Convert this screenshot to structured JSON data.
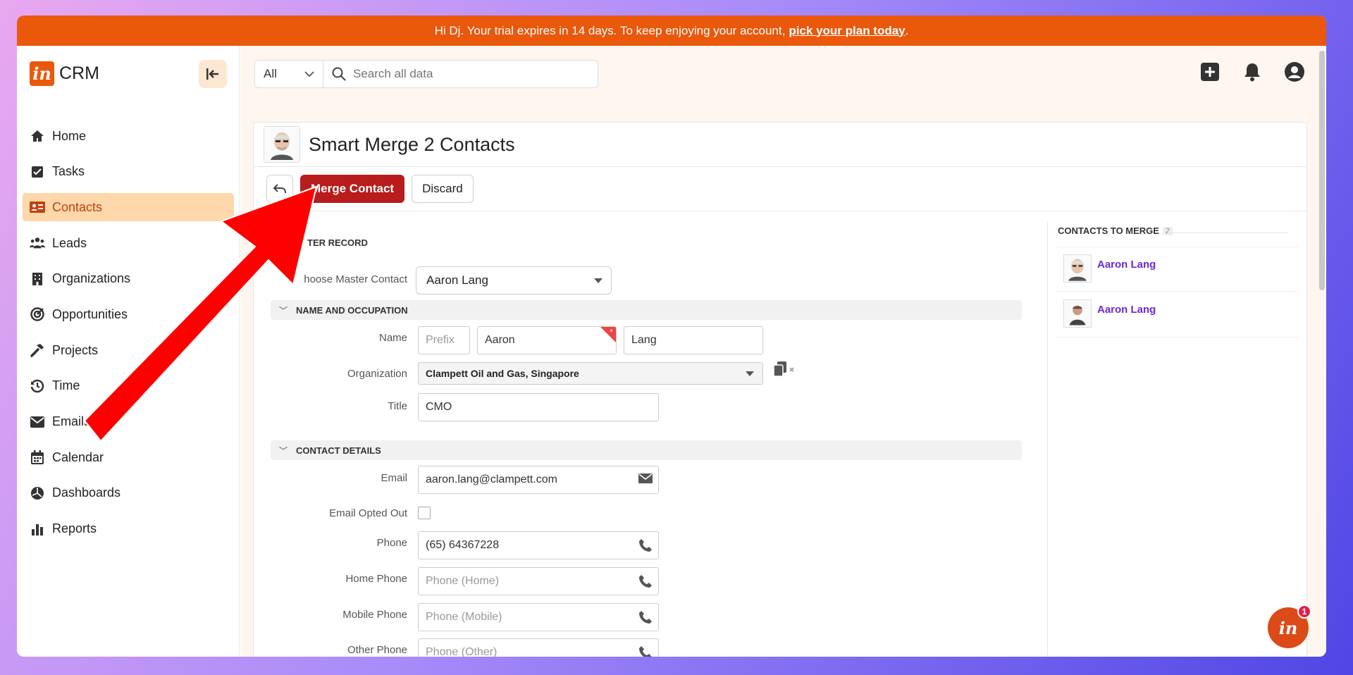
{
  "banner": {
    "text": "Hi Dj. Your trial expires in 14 days. To keep enjoying your account,",
    "link": "pick your plan today",
    "suffix": "."
  },
  "brand": {
    "logo": "in",
    "name": "CRM"
  },
  "nav": [
    {
      "label": "Home",
      "icon": "home-icon"
    },
    {
      "label": "Tasks",
      "icon": "checkbox-icon"
    },
    {
      "label": "Contacts",
      "icon": "contact-card-icon",
      "active": true
    },
    {
      "label": "Leads",
      "icon": "users-icon"
    },
    {
      "label": "Organizations",
      "icon": "building-icon"
    },
    {
      "label": "Opportunities",
      "icon": "target-icon"
    },
    {
      "label": "Projects",
      "icon": "hammer-icon"
    },
    {
      "label": "Time",
      "icon": "clock-icon"
    },
    {
      "label": "Emails",
      "icon": "envelope-icon"
    },
    {
      "label": "Calendar",
      "icon": "calendar-icon"
    },
    {
      "label": "Dashboards",
      "icon": "chart-pie-icon"
    },
    {
      "label": "Reports",
      "icon": "bar-chart-icon"
    }
  ],
  "search": {
    "scope": "All",
    "placeholder": "Search all data"
  },
  "page": {
    "title": "Smart Merge 2 Contacts",
    "merge_label": "Merge Contact",
    "discard_label": "Discard",
    "master_section": "TER RECORD",
    "master_label": "hoose Master Contact",
    "master_value": "Aaron Lang"
  },
  "sections": {
    "name_occupation": "NAME AND OCCUPATION",
    "contact_details": "CONTACT DETAILS"
  },
  "fields": {
    "name_label": "Name",
    "prefix_placeholder": "Prefix",
    "first_name": "Aaron",
    "last_name": "Lang",
    "org_label": "Organization",
    "org_value": "Clampett Oil and Gas, Singapore",
    "title_label": "Title",
    "title_value": "CMO",
    "email_label": "Email",
    "email_value": "aaron.lang@clampett.com",
    "opted_out_label": "Email Opted Out",
    "phone_label": "Phone",
    "phone_value": "(65) 64367228",
    "home_phone_label": "Home Phone",
    "home_phone_placeholder": "Phone (Home)",
    "mobile_phone_label": "Mobile Phone",
    "mobile_phone_placeholder": "Phone (Mobile)",
    "other_phone_label": "Other Phone",
    "other_phone_placeholder": "Phone (Other)"
  },
  "merge_panel": {
    "title": "CONTACTS TO MERGE",
    "count": "2",
    "contacts": [
      {
        "name": "Aaron Lang"
      },
      {
        "name": "Aaron Lang"
      }
    ]
  },
  "chat": {
    "logo": "in",
    "badge": "1"
  },
  "colors": {
    "brand": "#ea580c",
    "primary_button": "#b91c1c",
    "link": "#6d28d9",
    "annotation_arrow": "#ff0000"
  }
}
